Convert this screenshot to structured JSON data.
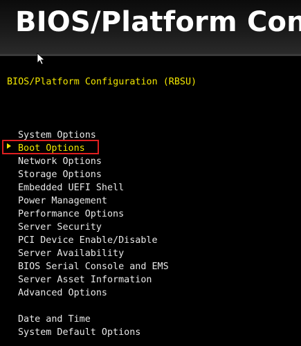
{
  "banner": {
    "title": "BIOS/Platform Configu"
  },
  "subtitle": "BIOS/Platform Configuration (RBSU)",
  "menu": {
    "items": [
      "System Options",
      "Boot Options",
      "Network Options",
      "Storage Options",
      "Embedded UEFI Shell",
      "Power Management",
      "Performance Options",
      "Server Security",
      "PCI Device Enable/Disable",
      "Server Availability",
      "BIOS Serial Console and EMS",
      "Server Asset Information",
      "Advanced Options",
      "Date and Time",
      "System Default Options"
    ],
    "selected_index": 1
  },
  "colors": {
    "background": "#000000",
    "text": "#e8e8e8",
    "accent_yellow": "#f2e600",
    "highlight_red": "#e02020"
  }
}
